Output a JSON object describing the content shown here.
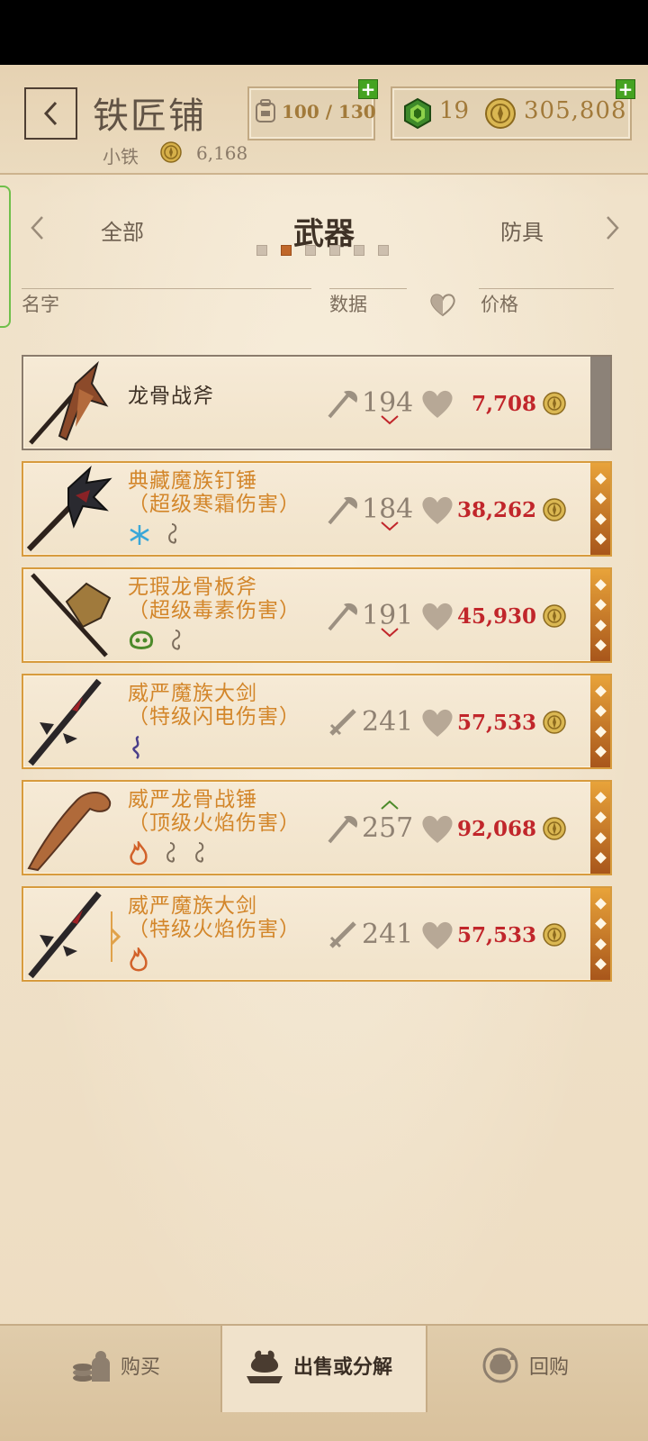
{
  "header": {
    "title": "铁匠铺",
    "merchant_name": "小铁",
    "merchant_gold": "6,168",
    "capacity": "100 / 130",
    "gems": "19",
    "gold": "305,808"
  },
  "categories": {
    "prev": "全部",
    "current": "武器",
    "next": "防具",
    "page_count": 6,
    "active_page": 2
  },
  "columns": {
    "name": "名字",
    "stats": "数据",
    "price": "价格"
  },
  "items": [
    {
      "name_line1": "龙骨战斧",
      "name_line2": "",
      "stat": "194",
      "stat_type": "axe",
      "trend": "down",
      "price": "7,708",
      "enchants": [],
      "rarity": "common"
    },
    {
      "name_line1": "典藏魔族钉锤",
      "name_line2": "（超级寒霜伤害）",
      "stat": "184",
      "stat_type": "axe",
      "trend": "down",
      "price": "38,262",
      "enchants": [
        "frost",
        "hook"
      ],
      "rarity": "legendary"
    },
    {
      "name_line1": "无瑕龙骨板斧",
      "name_line2": "（超级毒素伤害）",
      "stat": "191",
      "stat_type": "axe",
      "trend": "down",
      "price": "45,930",
      "enchants": [
        "poison",
        "hook"
      ],
      "rarity": "legendary"
    },
    {
      "name_line1": "威严魔族大剑",
      "name_line2": "（特级闪电伤害）",
      "stat": "241",
      "stat_type": "sword",
      "trend": "none",
      "price": "57,533",
      "enchants": [
        "shock"
      ],
      "rarity": "legendary"
    },
    {
      "name_line1": "威严龙骨战锤",
      "name_line2": "（顶级火焰伤害）",
      "stat": "257",
      "stat_type": "axe",
      "trend": "up",
      "price": "92,068",
      "enchants": [
        "fire",
        "hook",
        "hook"
      ],
      "rarity": "legendary"
    },
    {
      "name_line1": "威严魔族大剑",
      "name_line2": "（特级火焰伤害）",
      "stat": "241",
      "stat_type": "sword",
      "trend": "none",
      "price": "57,533",
      "enchants": [
        "fire"
      ],
      "rarity": "legendary"
    }
  ],
  "bottom_nav": {
    "buy": "购买",
    "sell": "出售或分解",
    "buyback": "回购"
  },
  "colors": {
    "price_red": "#c1262b",
    "legendary_orange": "#d3862a",
    "accent_green": "#45a321"
  }
}
